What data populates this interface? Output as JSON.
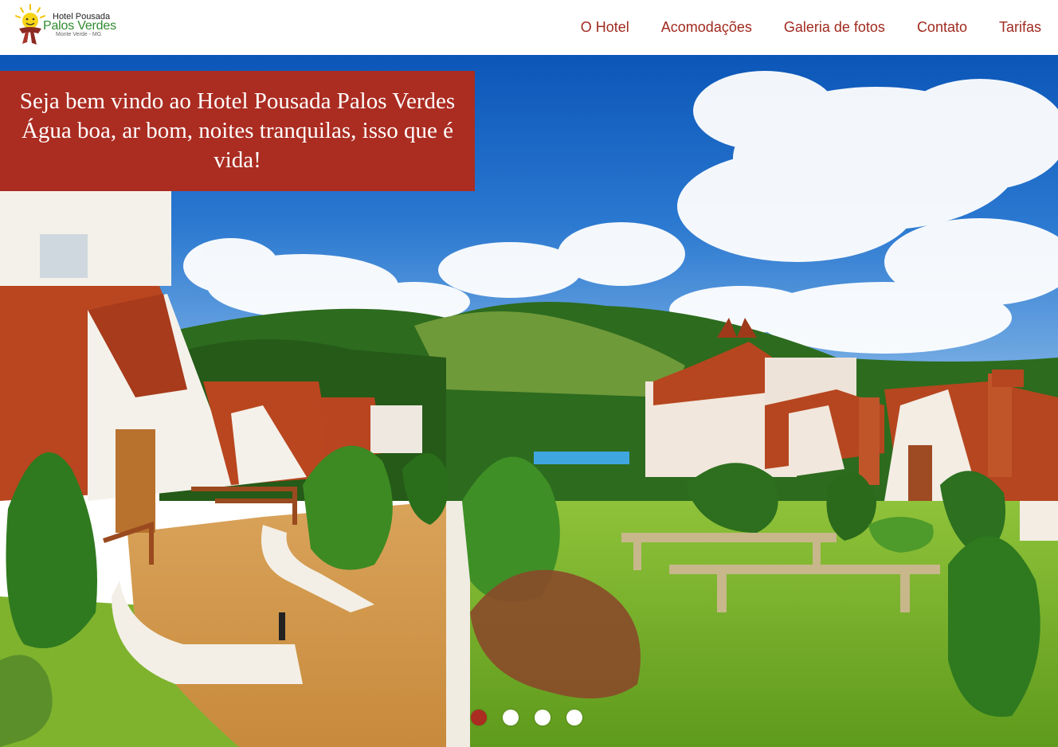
{
  "logo": {
    "line1": "Hotel Pousada",
    "line2": "Palos Verdes",
    "line3": "Monte Verde - MG"
  },
  "nav": {
    "items": [
      {
        "label": "O Hotel"
      },
      {
        "label": "Acomodações"
      },
      {
        "label": "Galeria de fotos"
      },
      {
        "label": "Contato"
      },
      {
        "label": "Tarifas"
      }
    ]
  },
  "hero": {
    "welcome": "Seja bem vindo ao Hotel Pousada Palos Verdes Água boa, ar bom, noites tranquilas, isso que é vida!",
    "slides": {
      "count": 4,
      "active_index": 0
    }
  },
  "colors": {
    "brand": "#ab2c21",
    "nav_text": "#a02a1f",
    "logo_green": "#2e8b2e"
  }
}
